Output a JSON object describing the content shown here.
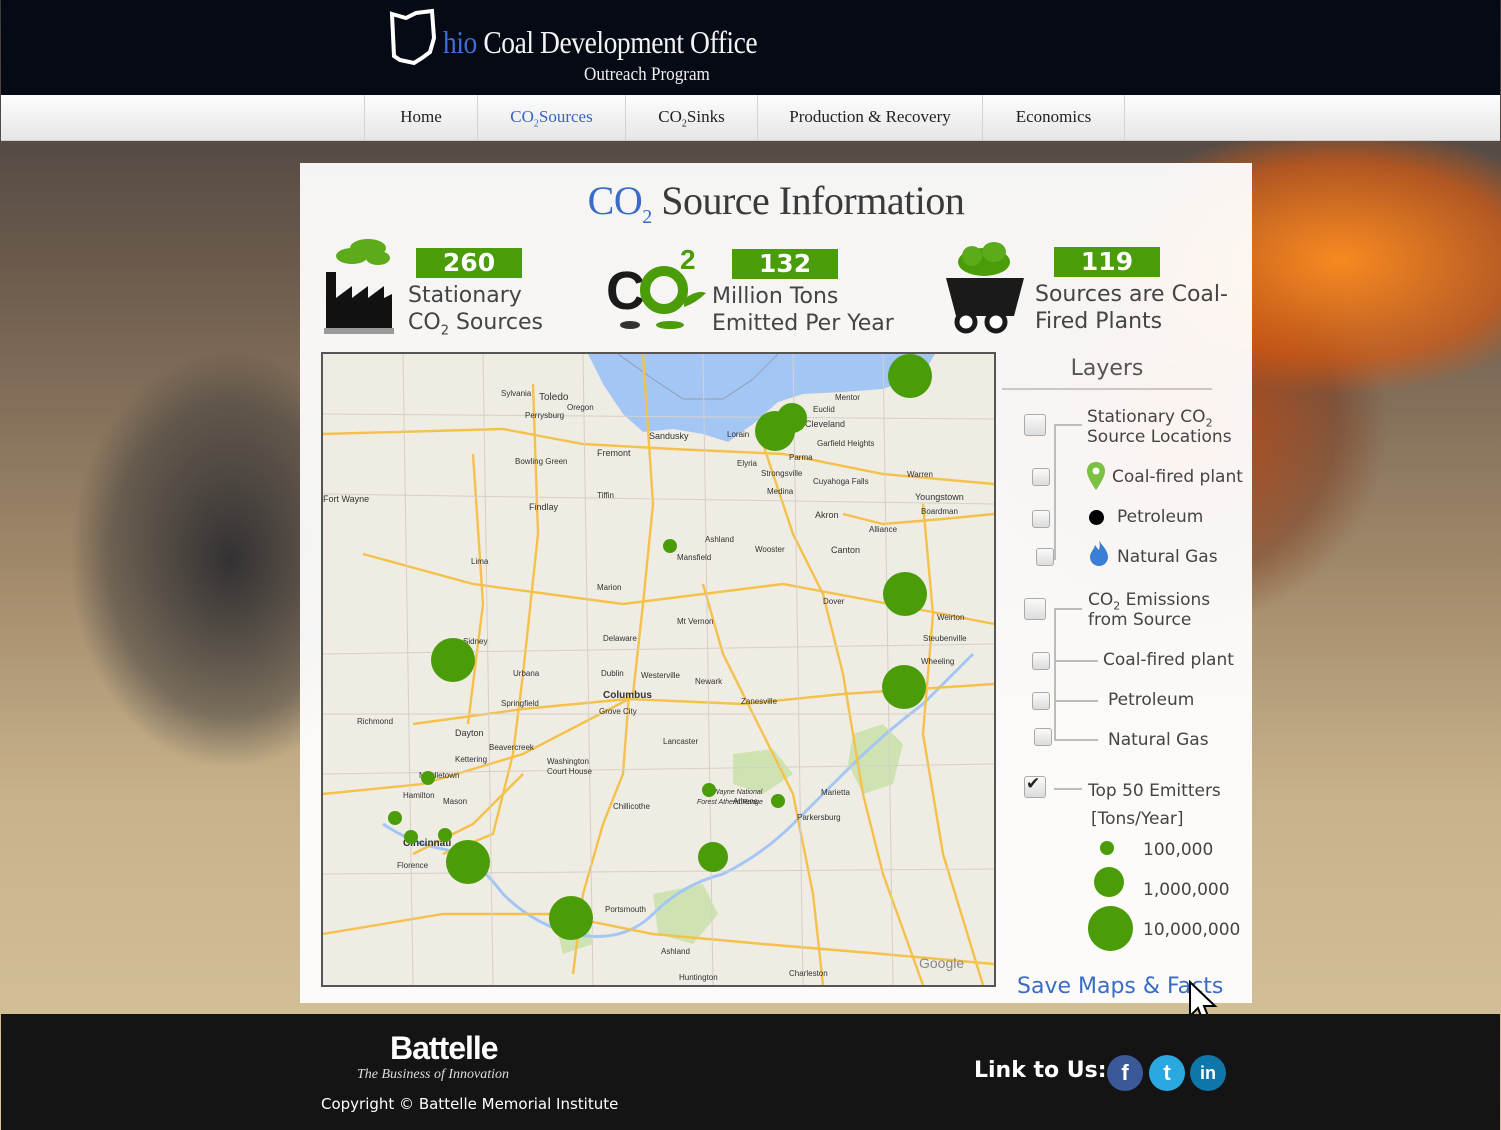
{
  "header": {
    "logo_title_blue": "hio",
    "logo_title_rest": " Coal Development Office",
    "logo_subtitle": "Outreach Program"
  },
  "nav": {
    "items": [
      {
        "label_pre": "CO",
        "label_sub": "",
        "label_post": "Home",
        "active": false
      },
      {
        "label_pre": "CO",
        "label_sub": "2",
        "label_post": "Sources",
        "active": true
      },
      {
        "label_pre": "CO",
        "label_sub": "2",
        "label_post": "Sinks",
        "active": false
      },
      {
        "label_pre": "",
        "label_sub": "",
        "label_post": "Production & Recovery",
        "active": false
      },
      {
        "label_pre": "",
        "label_sub": "",
        "label_post": "Economics",
        "active": false
      }
    ]
  },
  "panel": {
    "title_co": "CO",
    "title_sub": "2",
    "title_rest": " Source Information"
  },
  "stats": [
    {
      "value": "260",
      "line1": "Stationary",
      "line2_pre": "CO",
      "line2_sub": "2",
      "line2_post": " Sources",
      "icon": "factory-icon"
    },
    {
      "value": "132",
      "line1": "Million Tons",
      "line2_pre": "Emitted Per Year",
      "line2_sub": "",
      "line2_post": "",
      "icon": "co2-icon"
    },
    {
      "value": "119",
      "line1": "Sources are Coal-",
      "line2_pre": "Fired Plants",
      "line2_sub": "",
      "line2_post": "",
      "icon": "coal-cart-icon"
    }
  ],
  "map": {
    "labels": [
      "Toledo",
      "Sandusky",
      "Lorain",
      "Cleveland",
      "Mentor",
      "Fremont",
      "Bowling Green",
      "Elyria",
      "Strongsville",
      "Parma",
      "Warren",
      "Youngstown",
      "Findlay",
      "Tiffin",
      "Medina",
      "Akron",
      "Ashland",
      "Mansfield",
      "Wooster",
      "Canton",
      "Alliance",
      "Lima",
      "Marion",
      "Dover",
      "Weirton",
      "Steubenville",
      "Sidney",
      "Delaware",
      "Mt Vernon",
      "Urbana",
      "Dublin",
      "Westerville",
      "Newark",
      "Columbus",
      "Zanesville",
      "Springfield",
      "Grove City",
      "Dayton",
      "Richmond",
      "Lancaster",
      "Washington Court House",
      "Kettering",
      "Beavercreek",
      "Hamilton",
      "Middletown",
      "Mason",
      "Chillicothe",
      "Athens",
      "Marietta",
      "Parkersburg",
      "Cincinnati",
      "Florence",
      "Portsmouth",
      "Ashland",
      "Huntington",
      "Charleston",
      "Fort Wayne",
      "Google",
      "Sylvania",
      "Perrysburg",
      "Oregon",
      "Euclid",
      "Garfield Heights",
      "Cuyahoga Falls",
      "Boardman",
      "Wheeling",
      "Wayne National Forest Athens Range"
    ],
    "emitter_dot_radius_levels": "scaled by emissions"
  },
  "layers": {
    "title": "Layers",
    "group1_pre": "Stationary CO",
    "group1_sub": "2",
    "group1_post": "Source Locations",
    "g1_items": [
      "Coal-fired plant",
      "Petroleum",
      "Natural Gas"
    ],
    "group2_pre": "CO",
    "group2_sub": "2",
    "group2_mid": " Emissions",
    "group2_post": "from Source",
    "g2_items": [
      "Coal-fired plant",
      "Petroleum",
      "Natural Gas"
    ],
    "top50_line1": "Top 50 Emitters",
    "top50_line2": "[Tons/Year]",
    "legend": [
      "100,000",
      "1,000,000",
      "10,000,000"
    ],
    "top50_checked": true
  },
  "save_link": "Save Maps & Facts",
  "footer": {
    "brand": "Battelle",
    "tagline": "The Business of Innovation",
    "copyright": "Copyright © Battelle Memorial Institute",
    "link_label": "Link to Us:",
    "social": [
      {
        "name": "facebook",
        "glyph": "f",
        "color": "#3b5998"
      },
      {
        "name": "twitter",
        "glyph": "t",
        "color": "#2aa9e0"
      },
      {
        "name": "linkedin",
        "glyph": "in",
        "color": "#0e76a8"
      }
    ]
  },
  "colors": {
    "accent_green": "#4a9c08",
    "link_blue": "#3a6bc6",
    "header_bg": "#050a14",
    "footer_bg": "#141414"
  }
}
